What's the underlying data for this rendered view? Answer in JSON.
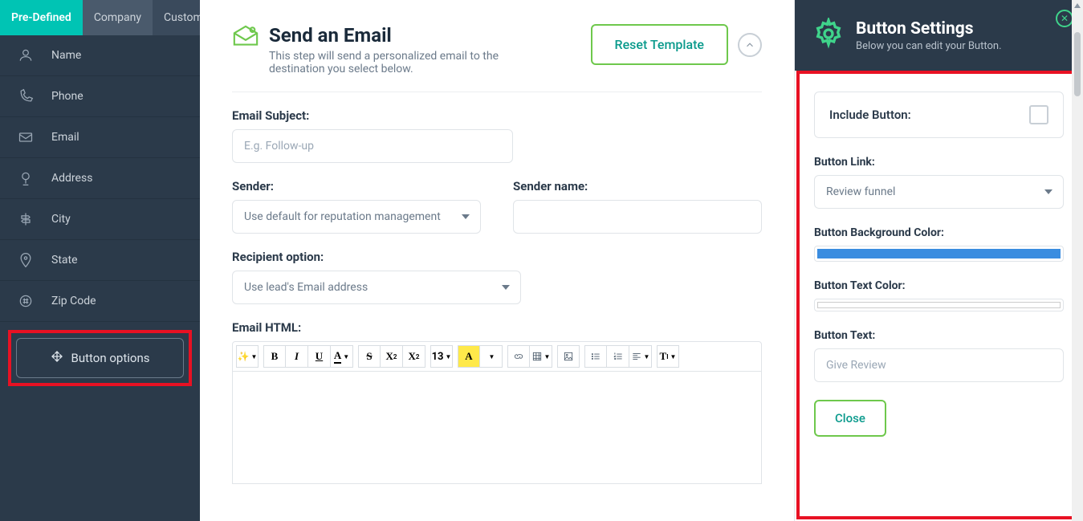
{
  "sidebar": {
    "tabs": [
      {
        "label": "Pre-Defined",
        "active": true
      },
      {
        "label": "Company",
        "active": false
      },
      {
        "label": "Custom",
        "active": false
      }
    ],
    "items": [
      {
        "label": "Name",
        "icon": "user-icon"
      },
      {
        "label": "Phone",
        "icon": "phone-icon"
      },
      {
        "label": "Email",
        "icon": "mail-icon"
      },
      {
        "label": "Address",
        "icon": "pin-icon"
      },
      {
        "label": "City",
        "icon": "signpost-icon"
      },
      {
        "label": "State",
        "icon": "map-pin-icon"
      },
      {
        "label": "Zip Code",
        "icon": "hash-icon"
      }
    ],
    "button_options": "Button options"
  },
  "main": {
    "title": "Send an Email",
    "subtitle": "This step will send a personalized email to the destination you select below.",
    "reset_label": "Reset Template",
    "email_subject_label": "Email Subject:",
    "email_subject_placeholder": "E.g. Follow-up",
    "sender_label": "Sender:",
    "sender_value": "Use default for reputation management",
    "sender_name_label": "Sender name:",
    "sender_name_value": "",
    "recipient_label": "Recipient option:",
    "recipient_value": "Use lead's Email address",
    "email_html_label": "Email HTML:",
    "toolbar": {
      "fontsize": "13"
    }
  },
  "panel": {
    "title": "Button Settings",
    "subtitle": "Below you can edit your Button.",
    "include_label": "Include Button:",
    "link_label": "Button Link:",
    "link_value": "Review funnel",
    "bg_label": "Button Background Color:",
    "bg_color": "#3a8de0",
    "text_color_label": "Button Text Color:",
    "text_color": "#ffffff",
    "text_label": "Button Text:",
    "text_value": "Give Review",
    "close_label": "Close"
  }
}
